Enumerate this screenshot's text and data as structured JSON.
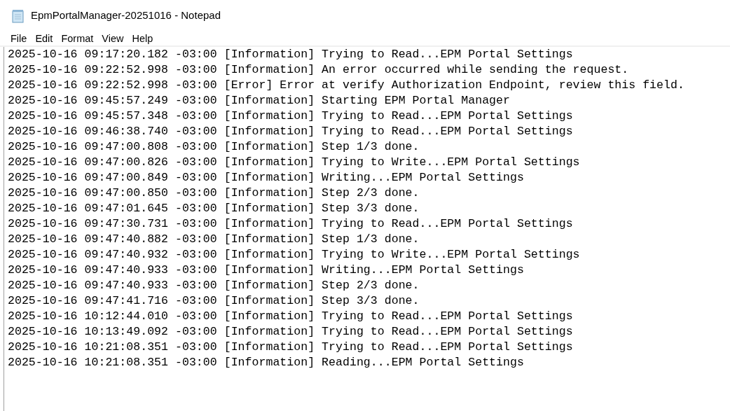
{
  "window": {
    "title": "EpmPortalManager-20251016 - Notepad"
  },
  "menu": [
    "File",
    "Edit",
    "Format",
    "View",
    "Help"
  ],
  "lines": [
    "2025-10-16 09:17:20.182 -03:00 [Information] Trying to Read...EPM Portal Settings",
    "2025-10-16 09:22:52.998 -03:00 [Information] An error occurred while sending the request.",
    "2025-10-16 09:22:52.998 -03:00 [Error] Error at verify Authorization Endpoint, review this field.",
    "2025-10-16 09:45:57.249 -03:00 [Information] Starting EPM Portal Manager",
    "2025-10-16 09:45:57.348 -03:00 [Information] Trying to Read...EPM Portal Settings",
    "2025-10-16 09:46:38.740 -03:00 [Information] Trying to Read...EPM Portal Settings",
    "2025-10-16 09:47:00.808 -03:00 [Information] Step 1/3 done.",
    "2025-10-16 09:47:00.826 -03:00 [Information] Trying to Write...EPM Portal Settings",
    "2025-10-16 09:47:00.849 -03:00 [Information] Writing...EPM Portal Settings",
    "2025-10-16 09:47:00.850 -03:00 [Information] Step 2/3 done.",
    "2025-10-16 09:47:01.645 -03:00 [Information] Step 3/3 done.",
    "2025-10-16 09:47:30.731 -03:00 [Information] Trying to Read...EPM Portal Settings",
    "2025-10-16 09:47:40.882 -03:00 [Information] Step 1/3 done.",
    "2025-10-16 09:47:40.932 -03:00 [Information] Trying to Write...EPM Portal Settings",
    "2025-10-16 09:47:40.933 -03:00 [Information] Writing...EPM Portal Settings",
    "2025-10-16 09:47:40.933 -03:00 [Information] Step 2/3 done.",
    "2025-10-16 09:47:41.716 -03:00 [Information] Step 3/3 done.",
    "2025-10-16 10:12:44.010 -03:00 [Information] Trying to Read...EPM Portal Settings",
    "2025-10-16 10:13:49.092 -03:00 [Information] Trying to Read...EPM Portal Settings",
    "2025-10-16 10:21:08.351 -03:00 [Information] Trying to Read...EPM Portal Settings",
    "2025-10-16 10:21:08.351 -03:00 [Information] Reading...EPM Portal Settings"
  ]
}
